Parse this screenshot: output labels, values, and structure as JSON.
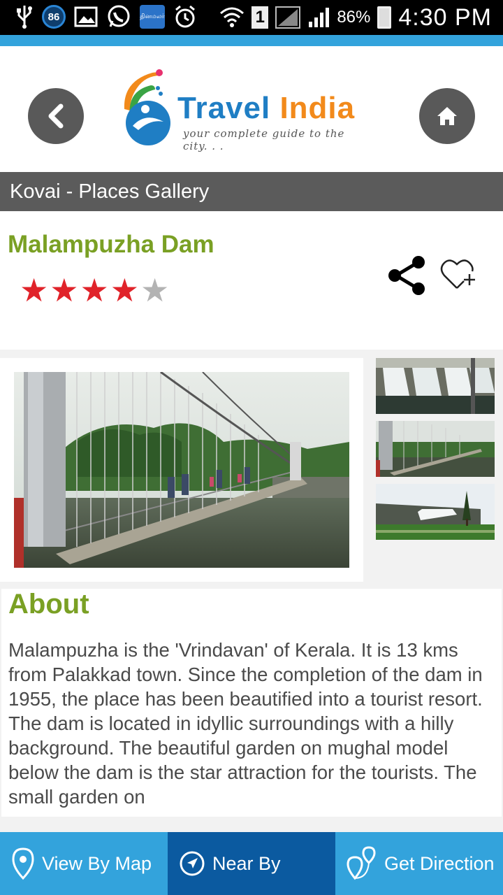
{
  "status_bar": {
    "notification_badge": "86",
    "app_icon_text": "தினமலர்",
    "sim_slot": "1",
    "battery": "86%",
    "time": "4:30 PM"
  },
  "header": {
    "logo_word1": "Travel",
    "logo_word2": "India",
    "logo_tagline": "your complete guide to the city. . ."
  },
  "page_title": "Kovai - Places Gallery",
  "place": {
    "name": "Malampuzha Dam",
    "rating": 4,
    "rating_max": 5
  },
  "about": {
    "heading": "About",
    "text": "Malampuzha is the 'Vrindavan' of Kerala. It is 13 kms from Palakkad town. Since the completion of the dam in 1955, the place has been beautified into a tourist resort. The dam is located in idyllic surroundings with a hilly background. The beautiful garden on mughal model below the dam is the star attraction for the tourists. The small garden on"
  },
  "bottom_nav": {
    "view_by_map": "View By Map",
    "near_by": "Near By",
    "get_direction": "Get Direction"
  },
  "colors": {
    "accent_blue": "#33a3dc",
    "active_tab_blue": "#0b5aa0",
    "title_green": "#7aa024",
    "star_red": "#e0232a",
    "header_gray": "#5b5b5b"
  }
}
